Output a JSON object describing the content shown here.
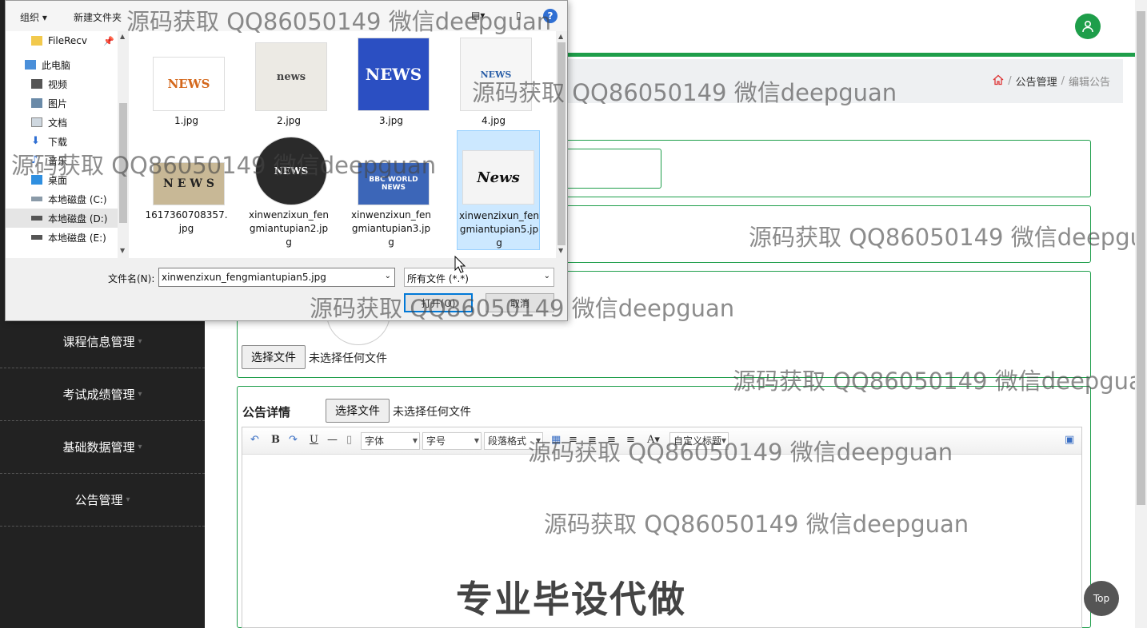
{
  "sidebar": {
    "items": [
      {
        "label": "课程信息管理"
      },
      {
        "label": "考试成绩管理"
      },
      {
        "label": "基础数据管理"
      },
      {
        "label": "公告管理"
      }
    ]
  },
  "header": {
    "user_icon": "user-icon"
  },
  "breadcrumb": {
    "home_icon": "home-icon",
    "section": "公告管理",
    "current": "编辑公告"
  },
  "form": {
    "cover": {
      "button_label": "选择文件",
      "status": "未选择任何文件"
    },
    "details": {
      "label": "公告详情",
      "button_label": "选择文件",
      "status": "未选择任何文件"
    }
  },
  "editor": {
    "font_select": "字体",
    "size_select": "字号",
    "paragraph_select": "段落格式",
    "custom_title_select": "自定义标题"
  },
  "top_button": {
    "label": "Top"
  },
  "dialog": {
    "toolbar": {
      "organize": "组织",
      "new_folder": "新建文件夹"
    },
    "nav": [
      {
        "label": "FileRecv",
        "icon": "folder-icon"
      },
      {
        "label": "此电脑",
        "icon": "computer-icon"
      },
      {
        "label": "视频",
        "icon": "video-icon"
      },
      {
        "label": "图片",
        "icon": "picture-icon"
      },
      {
        "label": "文档",
        "icon": "document-icon"
      },
      {
        "label": "下载",
        "icon": "download-icon"
      },
      {
        "label": "音乐",
        "icon": "music-icon"
      },
      {
        "label": "桌面",
        "icon": "desktop-icon"
      },
      {
        "label": "本地磁盘 (C:)",
        "icon": "drive-icon"
      },
      {
        "label": "本地磁盘 (D:)",
        "icon": "drive-icon"
      },
      {
        "label": "本地磁盘 (E:)",
        "icon": "drive-icon"
      }
    ],
    "files": [
      {
        "name": "1.jpg",
        "thumb": "NEWS"
      },
      {
        "name": "2.jpg",
        "thumb": "news"
      },
      {
        "name": "3.jpg",
        "thumb": "NEWS"
      },
      {
        "name": "4.jpg",
        "thumb": "NEWS"
      },
      {
        "name": "1617360708357.jpg",
        "thumb": "N E W S"
      },
      {
        "name": "xinwenzixun_fengmiantupian2.jpg",
        "thumb": "NEWS"
      },
      {
        "name": "xinwenzixun_fengmiantupian3.jpg",
        "thumb": "BBC WORLD NEWS"
      },
      {
        "name": "xinwenzixun_fengmiantupian5.jpg",
        "thumb": "News"
      }
    ],
    "filename_label": "文件名(N):",
    "filename_value": "xinwenzixun_fengmiantupian5.jpg",
    "filetype_value": "所有文件 (*.*)",
    "open_button": "打开(O)",
    "cancel_button": "取消"
  },
  "watermark": "源码获取 QQ86050149 微信deepguan",
  "promo": "专业毕设代做",
  "colors": {
    "accent": "#1e9e4a",
    "sidebar_bg": "#222222"
  }
}
